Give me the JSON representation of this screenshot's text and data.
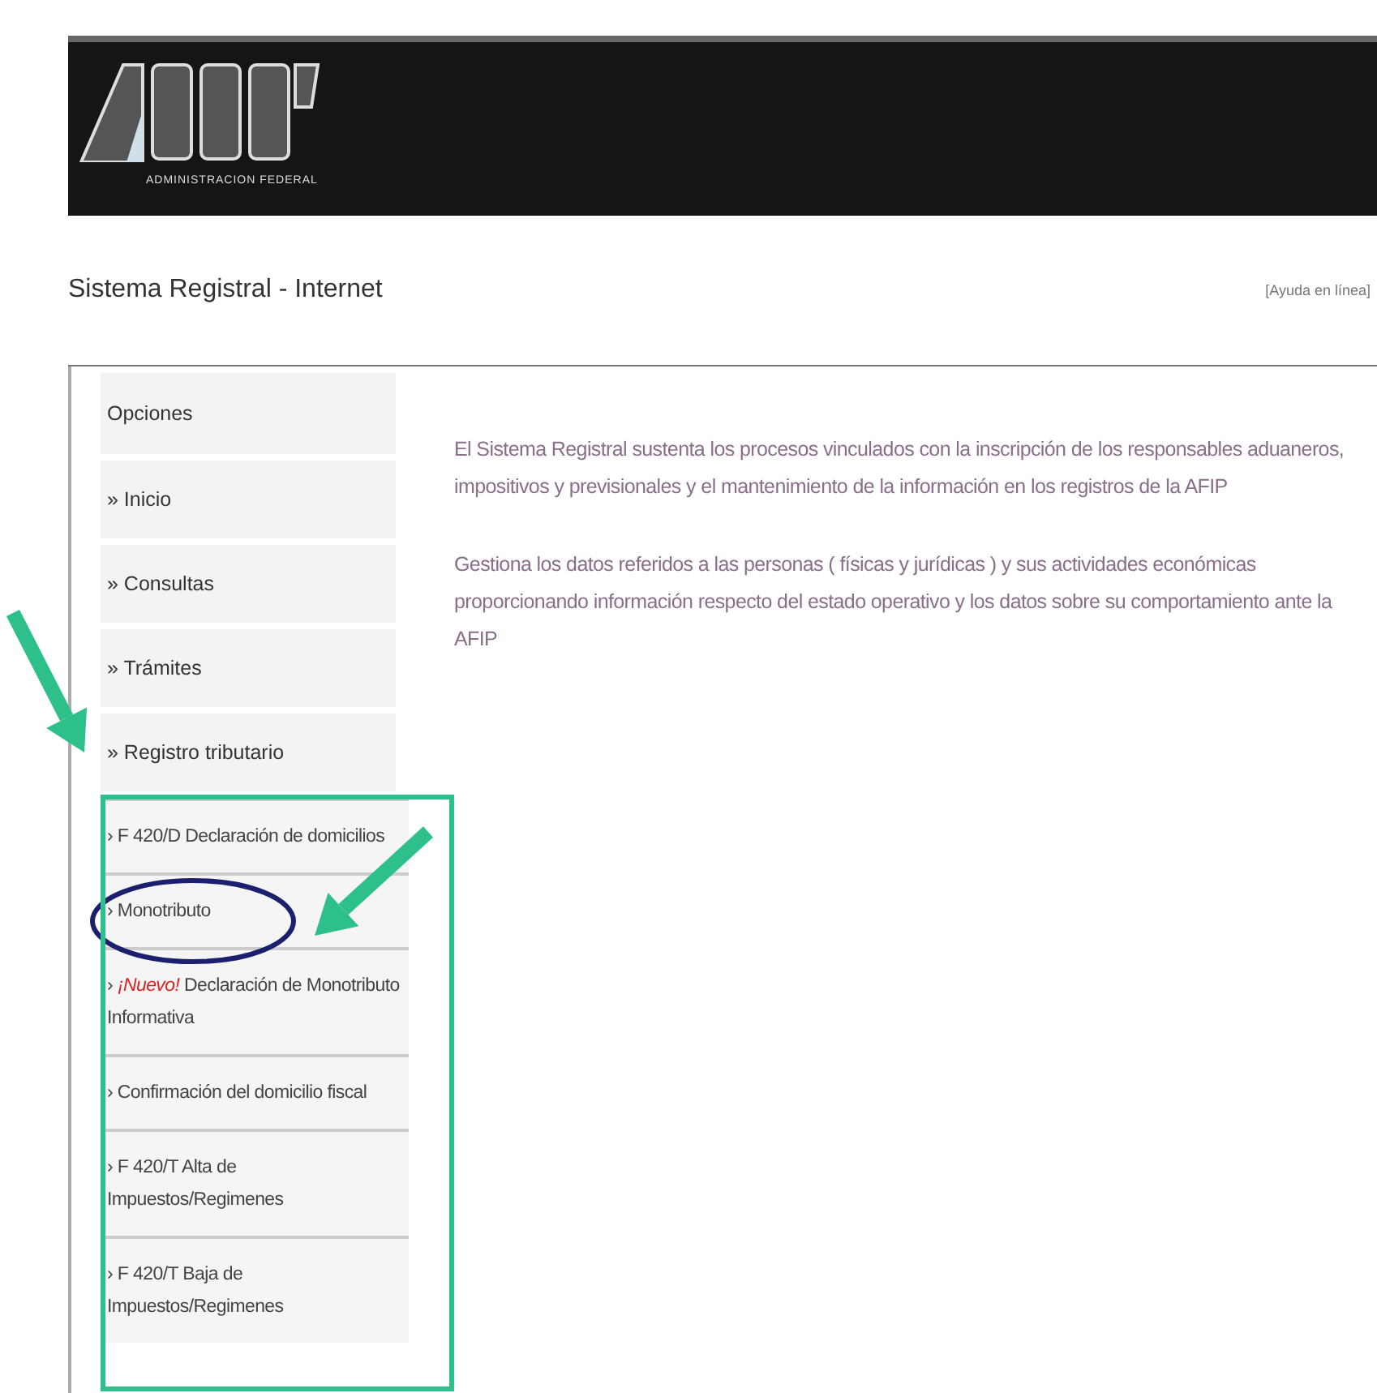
{
  "header": {
    "logo_caption": "ADMINISTRACION FEDERAL"
  },
  "page_title": "Sistema Registral - Internet",
  "help_link": "[Ayuda en línea]",
  "sidebar": {
    "items": [
      {
        "kind": "header",
        "label": "Opciones"
      },
      {
        "kind": "item",
        "label": "» Inicio"
      },
      {
        "kind": "item",
        "label": "» Consultas"
      },
      {
        "kind": "item",
        "label": "» Trámites"
      },
      {
        "kind": "item",
        "label": "» Registro tributario"
      },
      {
        "kind": "subitem",
        "label": "› F 420/D Declaración de domicilios"
      },
      {
        "kind": "subitem",
        "label": "› Monotributo"
      },
      {
        "kind": "subitem",
        "bullet": "›",
        "tag": "¡Nuevo!",
        "label": "Declaración de Monotributo Informativa"
      },
      {
        "kind": "subitem",
        "label": "› Confirmación del domicilio fiscal"
      },
      {
        "kind": "subitem",
        "label": "› F 420/T Alta de Impuestos/Regimenes"
      },
      {
        "kind": "subitem",
        "label": "› F 420/T Baja de Impuestos/Regimenes"
      }
    ]
  },
  "content": {
    "paragraphs": [
      "El Sistema Registral sustenta los procesos vinculados con la inscripción de los responsables aduaneros, impositivos y previsionales y el mantenimiento de la información en los registros de la AFIP",
      "Gestiona los datos referidos a las personas ( físicas y jurídicas ) y sus actividades económicas proporcionando información respecto del estado operativo y los datos sobre su comportamiento ante la AFIP"
    ]
  },
  "annotations": [
    {
      "kind": "arrow"
    },
    {
      "kind": "arrow"
    },
    {
      "kind": "ellipse"
    },
    {
      "kind": "frame"
    }
  ]
}
